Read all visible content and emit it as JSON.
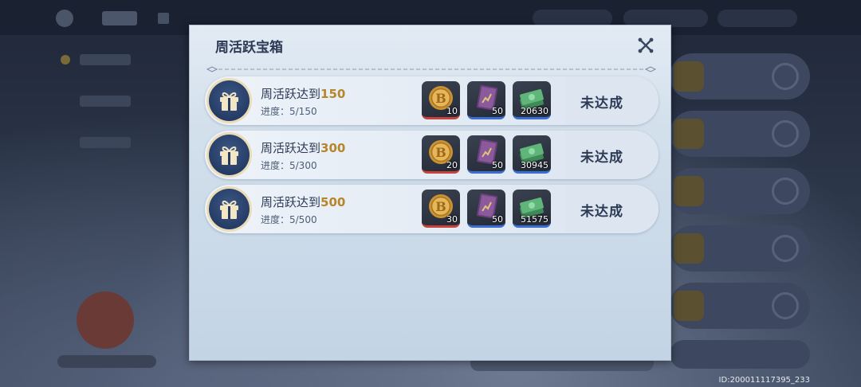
{
  "modal": {
    "title": "周活跃宝箱",
    "close_icon": "close-x-icon"
  },
  "tasks": [
    {
      "label": "周活跃达到",
      "target": "150",
      "progress_label": "进度：5/150",
      "rewards": [
        {
          "icon": "gold-coin-icon",
          "count": "10",
          "rarity_color": "#c8433c"
        },
        {
          "icon": "purple-book-icon",
          "count": "50",
          "rarity_color": "#3a6fd1"
        },
        {
          "icon": "cash-stack-icon",
          "count": "20630",
          "rarity_color": "#3a6fd1"
        }
      ],
      "status": "未达成"
    },
    {
      "label": "周活跃达到",
      "target": "300",
      "progress_label": "进度：5/300",
      "rewards": [
        {
          "icon": "gold-coin-icon",
          "count": "20",
          "rarity_color": "#c8433c"
        },
        {
          "icon": "purple-book-icon",
          "count": "50",
          "rarity_color": "#3a6fd1"
        },
        {
          "icon": "cash-stack-icon",
          "count": "30945",
          "rarity_color": "#3a6fd1"
        }
      ],
      "status": "未达成"
    },
    {
      "label": "周活跃达到",
      "target": "500",
      "progress_label": "进度：5/500",
      "rewards": [
        {
          "icon": "gold-coin-icon",
          "count": "30",
          "rarity_color": "#c8433c"
        },
        {
          "icon": "purple-book-icon",
          "count": "50",
          "rarity_color": "#3a6fd1"
        },
        {
          "icon": "cash-stack-icon",
          "count": "51575",
          "rarity_color": "#3a6fd1"
        }
      ],
      "status": "未达成"
    }
  ],
  "footer": {
    "player_id": "ID:200011117395_233"
  },
  "colors": {
    "target_highlight": "#b8862a",
    "title_text": "#2c3a55"
  }
}
